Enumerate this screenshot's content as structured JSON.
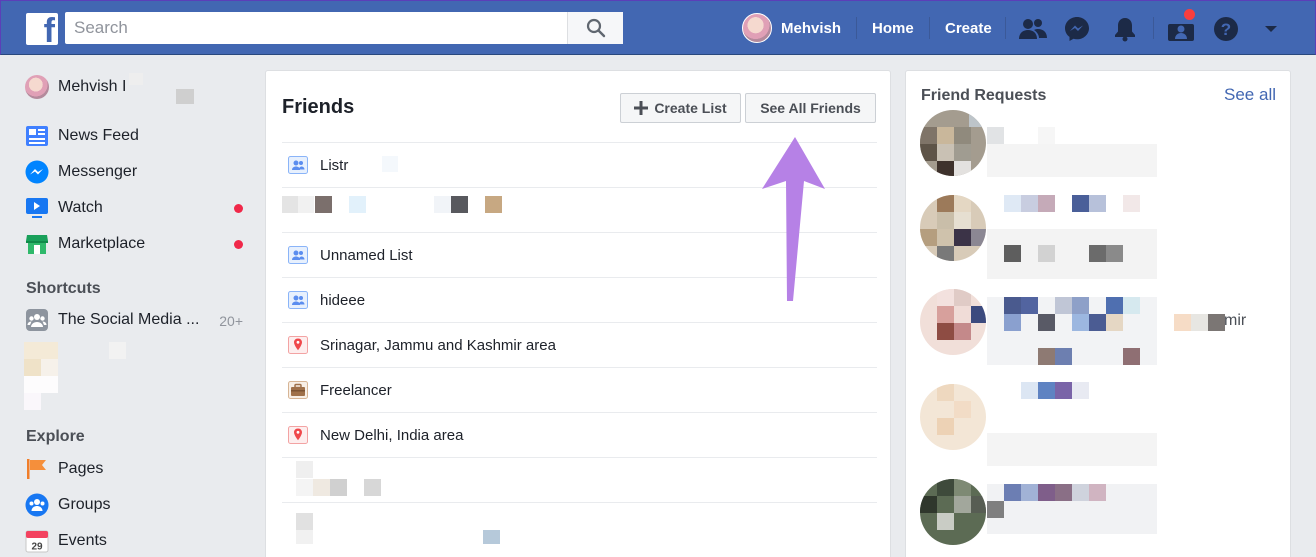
{
  "topbar": {
    "logo_letter": "f",
    "search_placeholder": "Search",
    "profile_name": "Mehvish",
    "home_label": "Home",
    "create_label": "Create",
    "brand_color": "#4267b2"
  },
  "leftnav": {
    "profile_name": "Mehvish I",
    "items": [
      {
        "label": "News Feed",
        "icon": "news-feed-icon"
      },
      {
        "label": "Messenger",
        "icon": "messenger-icon"
      },
      {
        "label": "Watch",
        "icon": "watch-icon",
        "dot": true
      },
      {
        "label": "Marketplace",
        "icon": "marketplace-icon",
        "dot": true
      }
    ],
    "shortcuts_heading": "Shortcuts",
    "shortcut_label": "The Social Media ...",
    "shortcut_count": "20+",
    "explore_heading": "Explore",
    "explore_items": [
      {
        "label": "Pages",
        "icon": "pages-flag-icon"
      },
      {
        "label": "Groups",
        "icon": "groups-icon"
      },
      {
        "label": "Events",
        "icon": "events-calendar-icon",
        "calendar_day": "29"
      }
    ]
  },
  "friends": {
    "title": "Friends",
    "create_list_label": "Create List",
    "see_all_label": "See All Friends",
    "lists": [
      {
        "label": "Listr",
        "icon": "friend-list-icon"
      },
      {
        "label": "",
        "icon": ""
      },
      {
        "label": "Unnamed List",
        "icon": "friend-list-icon"
      },
      {
        "label": "hideee",
        "icon": "friend-list-icon"
      },
      {
        "label": "Srinagar, Jammu and Kashmir area",
        "icon": "location-pin-icon"
      },
      {
        "label": "Freelancer",
        "icon": "briefcase-icon"
      },
      {
        "label": "New Delhi, India area",
        "icon": "location-pin-icon"
      }
    ]
  },
  "requests": {
    "title": "Friend Requests",
    "see_all_label": "See all",
    "partial_name_tail": "mir"
  }
}
